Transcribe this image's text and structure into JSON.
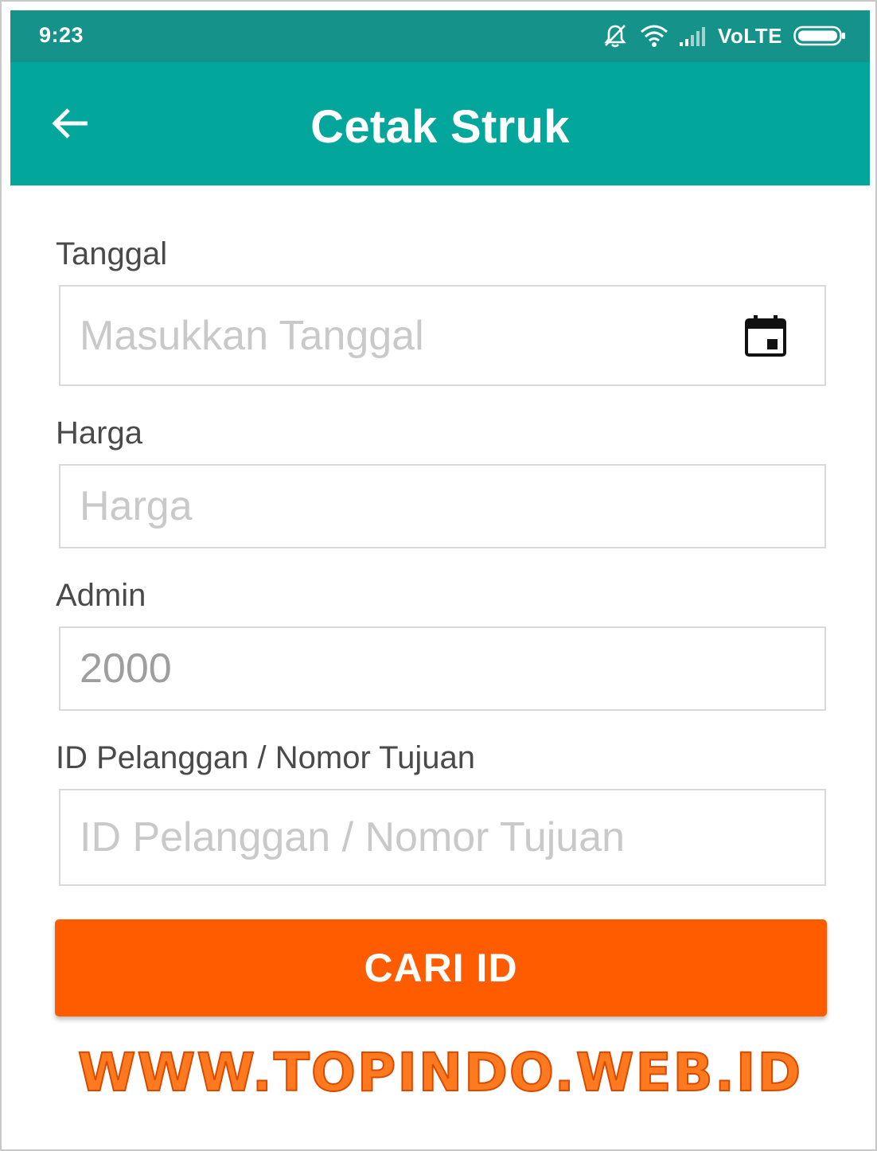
{
  "status_bar": {
    "time": "9:23",
    "network_label": "VoLTE",
    "icons": [
      "mute-notification-icon",
      "wifi-icon",
      "signal-icon",
      "battery-icon"
    ]
  },
  "app_bar": {
    "title": "Cetak Struk",
    "back_icon": "arrow-left-icon"
  },
  "form": {
    "tanggal": {
      "label": "Tanggal",
      "placeholder": "Masukkan Tanggal",
      "value": "",
      "icon": "calendar-icon"
    },
    "harga": {
      "label": "Harga",
      "placeholder": "Harga",
      "value": ""
    },
    "admin": {
      "label": "Admin",
      "placeholder": "",
      "value": "2000"
    },
    "id_pelanggan": {
      "label": "ID Pelanggan / Nomor Tujuan",
      "placeholder": "ID Pelanggan / Nomor Tujuan",
      "value": ""
    }
  },
  "actions": {
    "cari_id_label": "CARI ID"
  },
  "watermark": {
    "text": "WWW.TOPINDO.WEB.ID"
  },
  "colors": {
    "status_bar": "#15938a",
    "app_bar": "#03a69b",
    "button": "#ff5c00",
    "watermark": "#ff7a1e"
  }
}
